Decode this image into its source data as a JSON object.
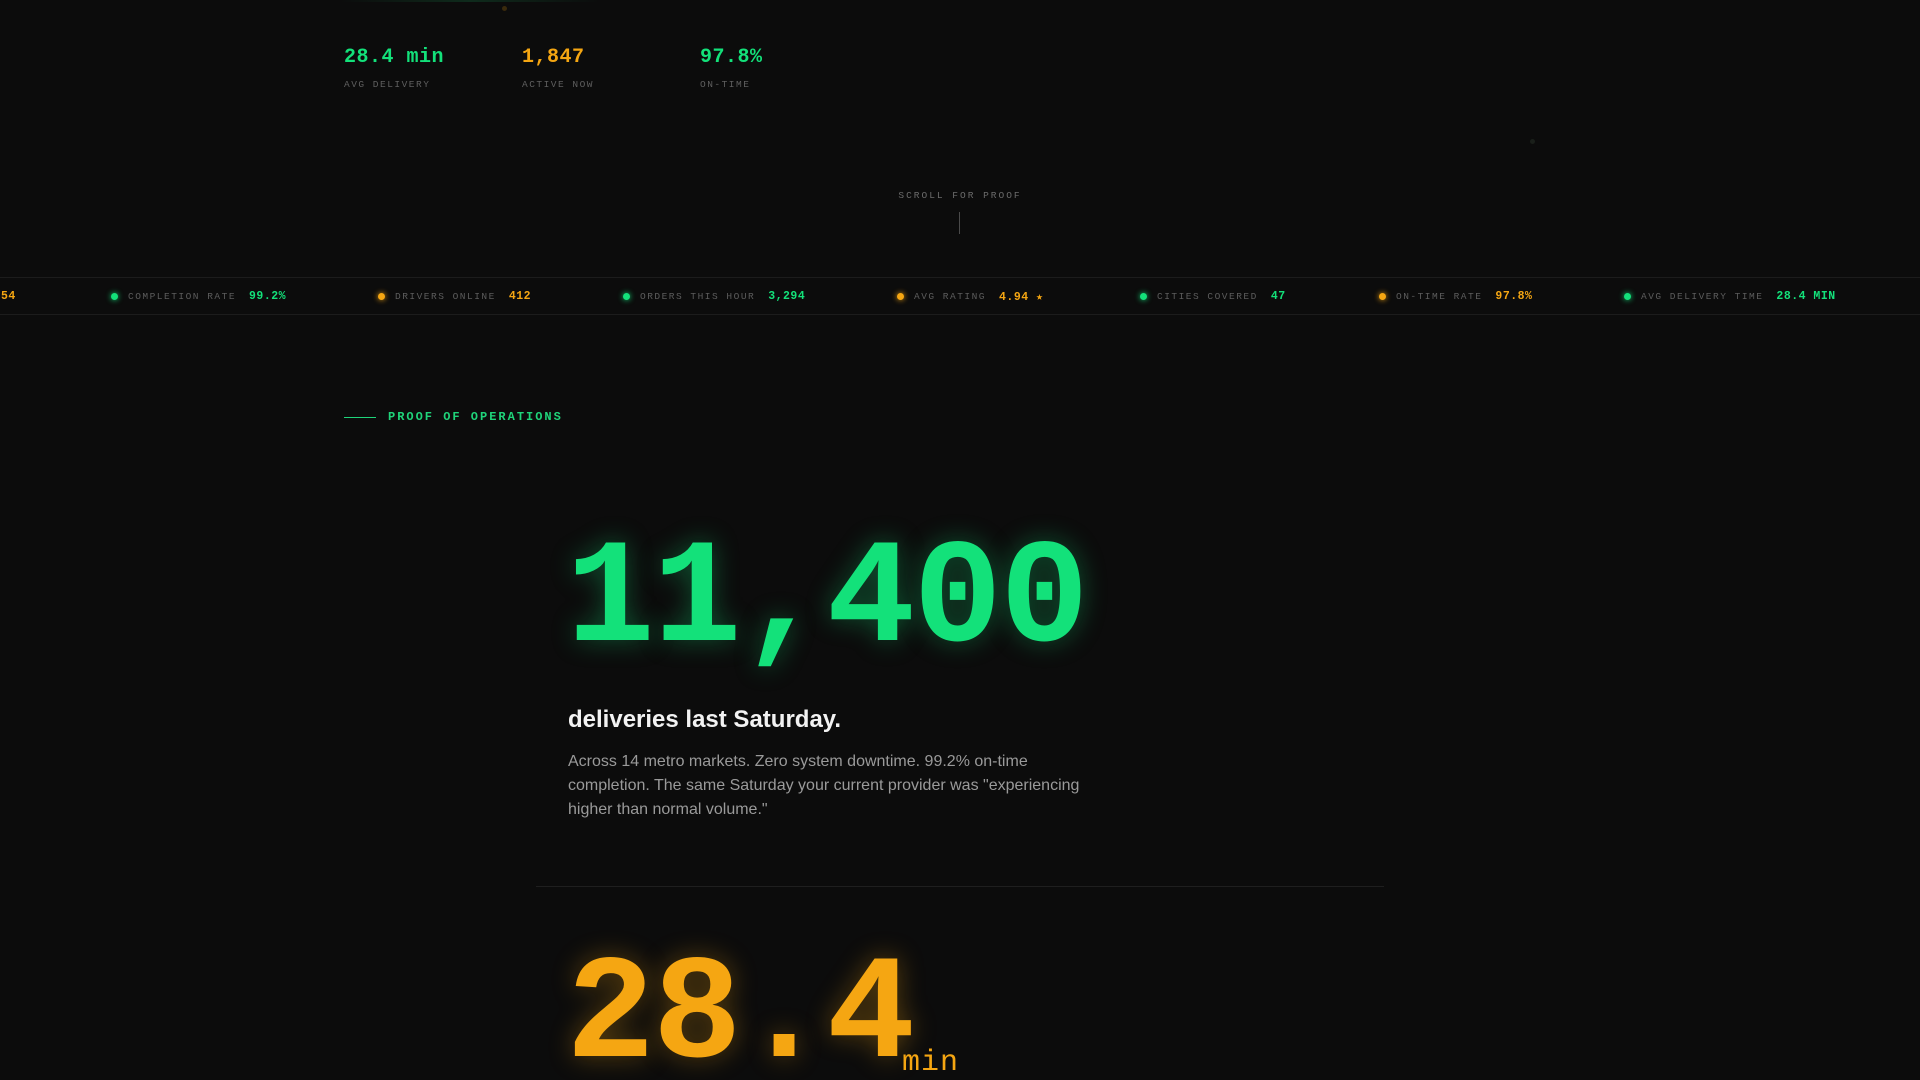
{
  "colors": {
    "background": "#0c0c0c",
    "green": "#13e17a",
    "amber": "#f5a612",
    "muted": "#5f5f5f"
  },
  "hero_stats": [
    {
      "value": "28.4 min",
      "label": "AVG DELIVERY",
      "color": "#13e17a"
    },
    {
      "value": "1,847",
      "label": "ACTIVE NOW",
      "color": "#f5a612"
    },
    {
      "value": "97.8%",
      "label": "ON-TIME",
      "color": "#13e17a"
    }
  ],
  "scroll_hint": "SCROLL FOR PROOF",
  "ticker": {
    "partial_value": "54",
    "items": [
      {
        "label": "COMPLETION RATE",
        "value": "99.2%",
        "color": "#13e17a"
      },
      {
        "label": "DRIVERS ONLINE",
        "value": "412",
        "color": "#f5a612"
      },
      {
        "label": "ORDERS THIS HOUR",
        "value": "3,294",
        "color": "#13e17a"
      },
      {
        "label": "AVG RATING",
        "value": "4.94 ★",
        "color": "#f5a612"
      },
      {
        "label": "CITIES COVERED",
        "value": "47",
        "color": "#13e17a"
      },
      {
        "label": "ON-TIME RATE",
        "value": "97.8%",
        "color": "#f5a612"
      },
      {
        "label": "AVG DELIVERY TIME",
        "value": "28.4 MIN",
        "color": "#13e17a"
      }
    ]
  },
  "proof": {
    "section_label": "PROOF OF OPERATIONS",
    "metric_1": {
      "value": "11,400",
      "headline": "deliveries last Saturday.",
      "description": "Across 14 metro markets. Zero system downtime. 99.2% on-time completion. The same Saturday your current provider was \"experiencing higher than normal volume.\""
    },
    "metric_2": {
      "value": "28.4",
      "unit": "min"
    }
  }
}
